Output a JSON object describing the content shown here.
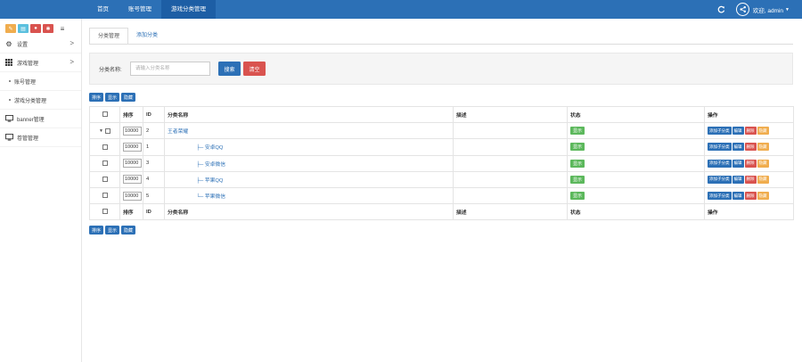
{
  "header": {
    "nav": [
      "首页",
      "账号管理",
      "游戏分类管理"
    ],
    "active_nav": 2,
    "welcome": "欢迎, admin"
  },
  "sidebar": {
    "shortcut_colors": [
      "#f0ad4e",
      "#5bc0de",
      "#d9534f",
      "#d9534f"
    ],
    "items": [
      {
        "label": "设置",
        "icon": "gears-icon",
        "chevron": ">"
      },
      {
        "label": "游戏管理",
        "icon": "grid-icon",
        "chevron": ">"
      },
      {
        "label": "账号管理",
        "sub": true
      },
      {
        "label": "游戏分类管理",
        "sub": true
      },
      {
        "label": "banner管理",
        "icon": "monitor-icon"
      },
      {
        "label": "卷管管理",
        "icon": "monitor-icon"
      }
    ]
  },
  "tabs": [
    "分类管理",
    "添加分类"
  ],
  "search": {
    "label": "分类名称:",
    "placeholder": "请输入分类名称",
    "search_button": "搜索",
    "clear_button": "清空"
  },
  "actions": [
    "排序",
    "显示",
    "隐藏"
  ],
  "table": {
    "headers": [
      "排序",
      "ID",
      "分类名称",
      "描述",
      "状态",
      "操作"
    ],
    "rows": [
      {
        "sort": "10000",
        "id": "2",
        "name": "王者荣耀",
        "prefix": "",
        "desc": "",
        "status": "显示",
        "expand": "▼"
      },
      {
        "sort": "10000",
        "id": "1",
        "name": "安卓QQ",
        "prefix": "├─ ",
        "desc": "",
        "status": "显示"
      },
      {
        "sort": "10000",
        "id": "3",
        "name": "安卓微信",
        "prefix": "├─ ",
        "desc": "",
        "status": "显示"
      },
      {
        "sort": "10000",
        "id": "4",
        "name": "苹果QQ",
        "prefix": "├─ ",
        "desc": "",
        "status": "显示"
      },
      {
        "sort": "10000",
        "id": "5",
        "name": "苹果微信",
        "prefix": "└─ ",
        "desc": "",
        "status": "显示"
      }
    ],
    "ops": [
      "添加子分类",
      "编辑",
      "删除",
      "隐藏"
    ]
  }
}
